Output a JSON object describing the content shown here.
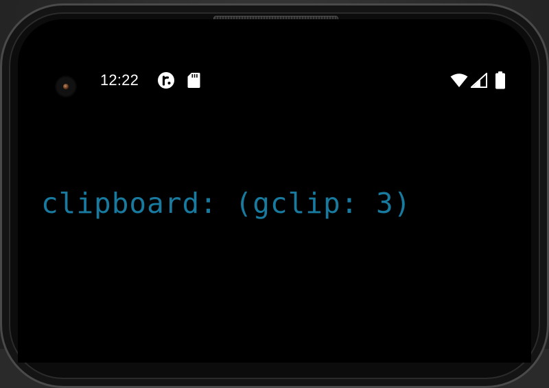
{
  "status_bar": {
    "time": "12:22",
    "notification_icons": [
      "r-badge-icon",
      "sd-card-icon"
    ],
    "system_icons": [
      "wifi-icon",
      "cellular-signal-icon",
      "battery-icon"
    ]
  },
  "terminal": {
    "output_line": "clipboard: (gclip: 3)",
    "text_color": "#177a9e",
    "background_color": "#000000"
  },
  "colors": {
    "status_text": "#ffffff",
    "frame": "#0c0c0c"
  }
}
